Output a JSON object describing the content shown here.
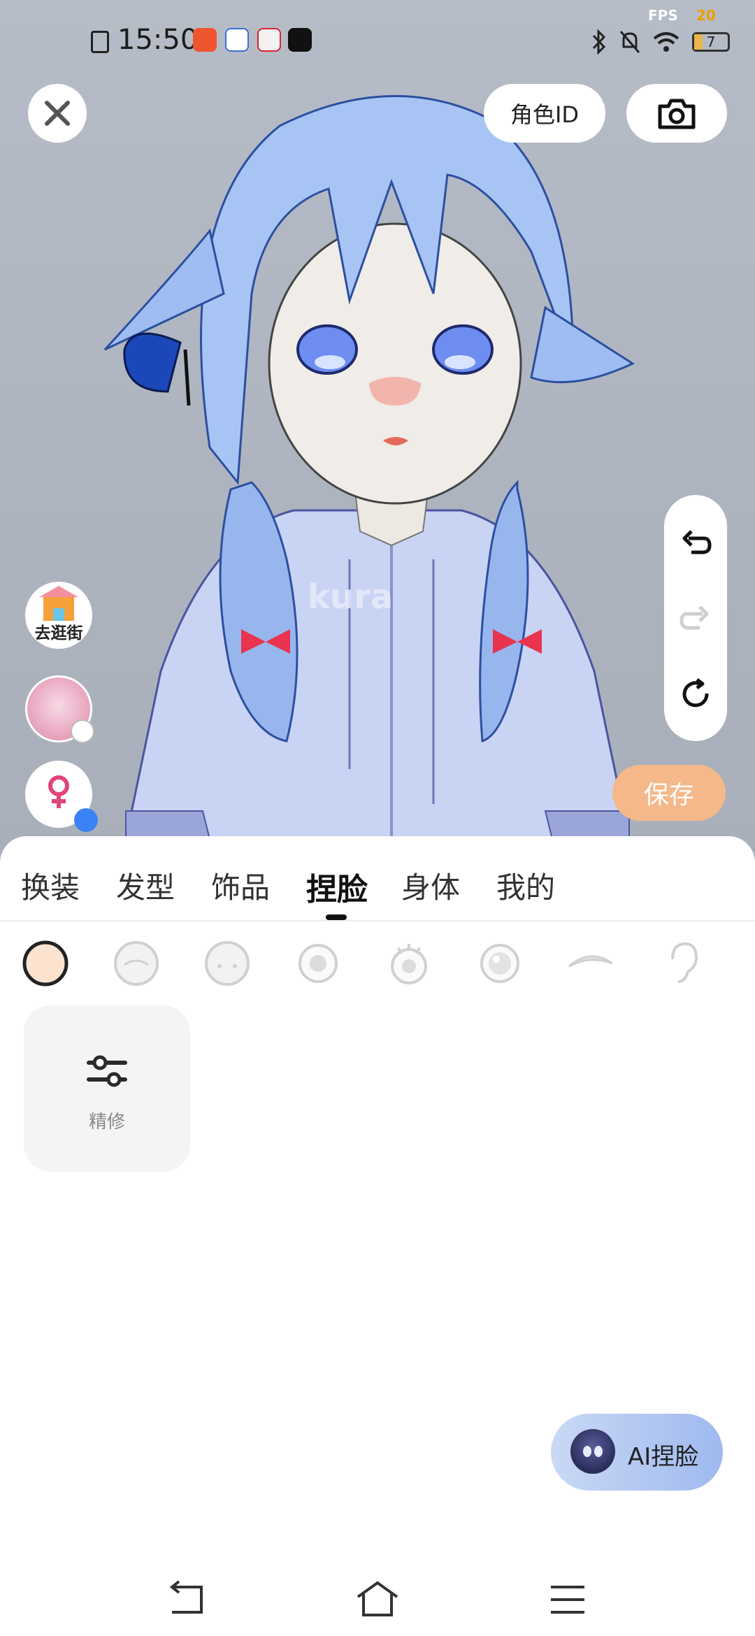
{
  "status_bar": {
    "time": "15:50",
    "fps_label": "FPS",
    "fps_value": "20",
    "battery": "7"
  },
  "top_actions": {
    "role_id_label": "角色ID"
  },
  "left_actions": {
    "shop_label": "去逛街"
  },
  "save_label": "保存",
  "tabs": [
    {
      "label": "换装"
    },
    {
      "label": "发型"
    },
    {
      "label": "饰品"
    },
    {
      "label": "捏脸",
      "active": true
    },
    {
      "label": "身体"
    },
    {
      "label": "我的"
    }
  ],
  "face_categories": [
    "face-shape-icon",
    "face-outline-icon",
    "face-expression-icon",
    "eye-icon",
    "eye-lashes-icon",
    "eye-pupil-icon",
    "eyebrow-icon",
    "ear-icon"
  ],
  "tools": [
    {
      "label": "精修",
      "icon": "sliders-icon"
    }
  ],
  "ai_button_label": "AI捏脸",
  "colors": {
    "save_bg": "#f5b88a",
    "ai_gradient_start": "#c9d9f5",
    "ai_gradient_end": "#9fb9ef",
    "gender_badge": "#3b82f6",
    "gender_symbol": "#e0457b"
  }
}
